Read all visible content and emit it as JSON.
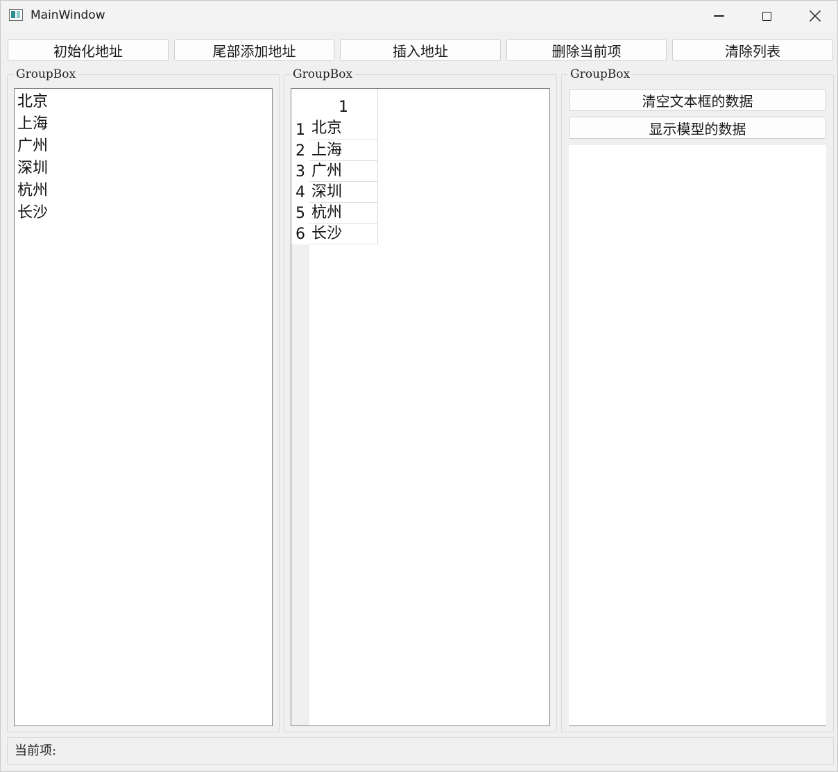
{
  "window": {
    "title": "MainWindow",
    "icon": "app-window-icon",
    "controls": [
      "minimize-icon",
      "maximize-icon",
      "close-icon"
    ]
  },
  "toolbar": {
    "buttons": [
      {
        "label": "初始化地址"
      },
      {
        "label": "尾部添加地址"
      },
      {
        "label": "插入地址"
      },
      {
        "label": "删除当前项"
      },
      {
        "label": "清除列表"
      }
    ]
  },
  "groups": [
    {
      "title": "GroupBox"
    },
    {
      "title": "GroupBox"
    },
    {
      "title": "GroupBox"
    }
  ],
  "list_view": {
    "items": [
      "北京",
      "上海",
      "广州",
      "深圳",
      "杭州",
      "长沙"
    ]
  },
  "table_view": {
    "column_header": "1",
    "row_headers": [
      "1",
      "2",
      "3",
      "4",
      "5",
      "6"
    ],
    "cells": [
      "北京",
      "上海",
      "广州",
      "深圳",
      "杭州",
      "长沙"
    ]
  },
  "side_panel": {
    "clear_button": "清空文本框的数据",
    "show_button": "显示模型的数据",
    "text_value": ""
  },
  "status": {
    "label": "当前项:"
  }
}
